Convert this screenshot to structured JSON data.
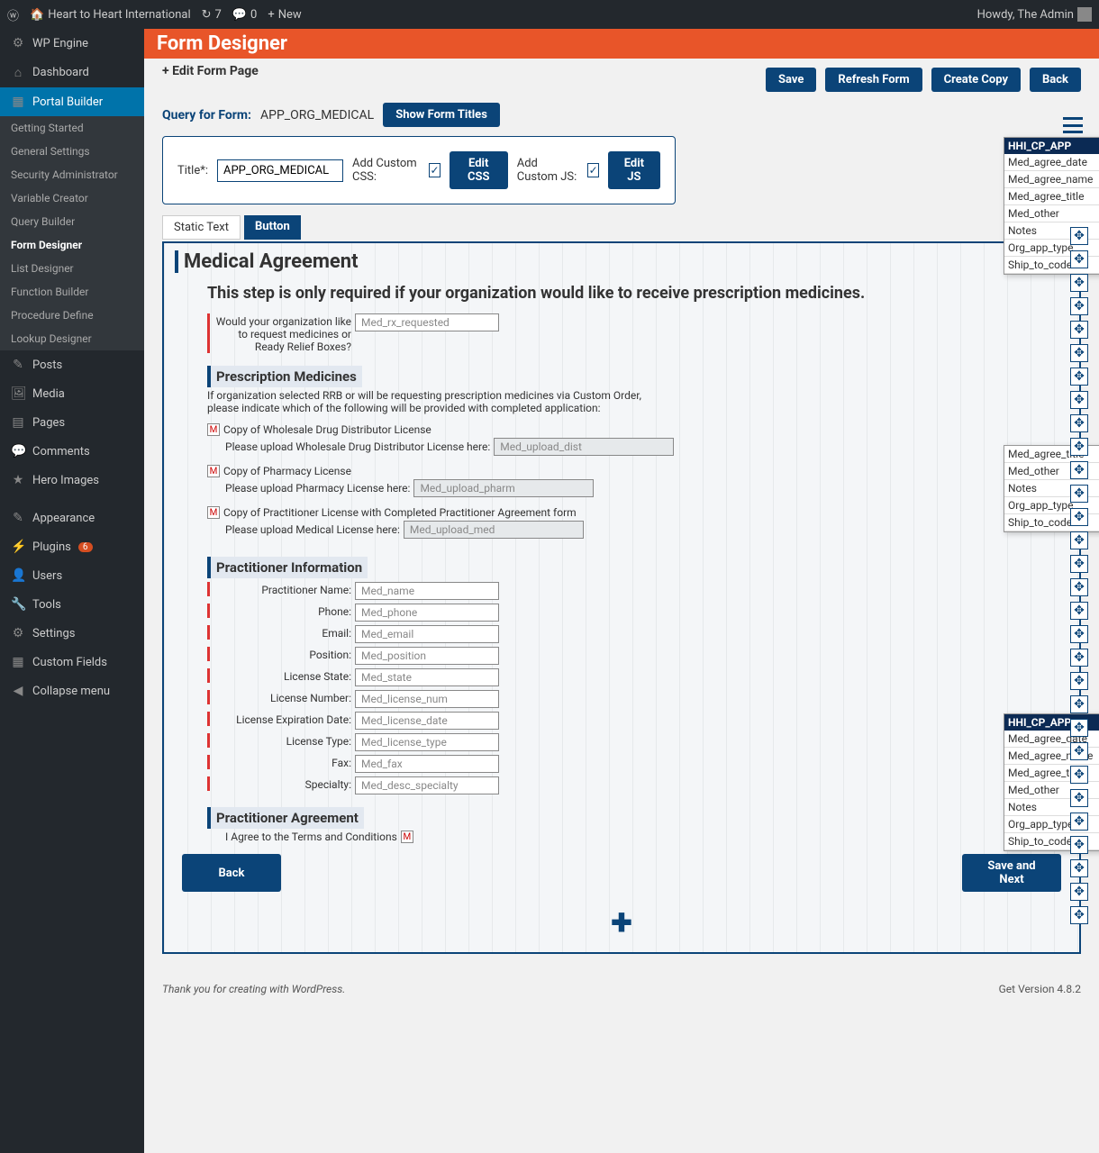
{
  "adminbar": {
    "site": "Heart to Heart International",
    "updates": "7",
    "comments": "0",
    "new": "New",
    "howdy": "Howdy, The Admin"
  },
  "sidebar": {
    "items": [
      {
        "label": "WP Engine"
      },
      {
        "label": "Dashboard"
      },
      {
        "label": "Portal Builder",
        "active": true
      },
      {
        "label": "Posts"
      },
      {
        "label": "Media"
      },
      {
        "label": "Pages"
      },
      {
        "label": "Comments"
      },
      {
        "label": "Hero Images"
      },
      {
        "label": "Appearance"
      },
      {
        "label": "Plugins",
        "badge": "6"
      },
      {
        "label": "Users"
      },
      {
        "label": "Tools"
      },
      {
        "label": "Settings"
      },
      {
        "label": "Custom Fields"
      },
      {
        "label": "Collapse menu"
      }
    ],
    "submenu": [
      "Getting Started",
      "General Settings",
      "Security Administrator",
      "Variable Creator",
      "Query Builder",
      "Form Designer",
      "List Designer",
      "Function Builder",
      "Procedure Define",
      "Lookup Designer"
    ],
    "submenu_active": "Form Designer"
  },
  "header": {
    "title": "Form Designer",
    "subtitle": "+ Edit Form Page",
    "buttons": {
      "save": "Save",
      "refresh": "Refresh Form",
      "copy": "Create Copy",
      "back": "Back"
    },
    "query_label": "Query for Form:",
    "query_value": "APP_ORG_MEDICAL",
    "show_titles": "Show Form Titles"
  },
  "titlebox": {
    "label": "Title*:",
    "value": "APP_ORG_MEDICAL",
    "css_label": "Add Custom CSS:",
    "edit_css": "Edit CSS",
    "js_label": "Add Custom JS:",
    "edit_js": "Edit JS"
  },
  "tabs": {
    "static": "Static Text",
    "button": "Button"
  },
  "form": {
    "main_title": "Medical Agreement",
    "step": "This step is only required if your organization would like to receive prescription medicines.",
    "q1_label": "Would your organization like to request medicines or Ready Relief Boxes?",
    "q1_ph": "Med_rx_requested",
    "rx_title": "Prescription Medicines",
    "rx_desc": "If organization selected RRB or will be requesting prescription medicines via Custom Order, please indicate which of the following will be provided with completed application:",
    "cb1": "Copy of Wholesale Drug Distributor License",
    "up1_label": "Please upload Wholesale Drug Distributor License here:",
    "up1_ph": "Med_upload_dist",
    "cb2": "Copy of Pharmacy License",
    "up2_label": "Please upload Pharmacy License here:",
    "up2_ph": "Med_upload_pharm",
    "cb3": "Copy of Practitioner License with Completed Practitioner Agreement form",
    "up3_label": "Please upload Medical License here:",
    "up3_ph": "Med_upload_med",
    "pi_title": "Practitioner Information",
    "fields": [
      {
        "label": "Practitioner Name:",
        "ph": "Med_name"
      },
      {
        "label": "Phone:",
        "ph": "Med_phone"
      },
      {
        "label": "Email:",
        "ph": "Med_email"
      },
      {
        "label": "Position:",
        "ph": "Med_position"
      },
      {
        "label": "License State:",
        "ph": "Med_state"
      },
      {
        "label": "License Number:",
        "ph": "Med_license_num"
      },
      {
        "label": "License Expiration Date:",
        "ph": "Med_license_date"
      },
      {
        "label": "License Type:",
        "ph": "Med_license_type"
      },
      {
        "label": "Fax:",
        "ph": "Med_fax"
      },
      {
        "label": "Specialty:",
        "ph": "Med_desc_specialty"
      }
    ],
    "pa_title": "Practitioner Agreement",
    "agree": "I Agree to the Terms and Conditions",
    "back": "Back",
    "save_next": "Save and Next"
  },
  "popup": {
    "header": "HHI_CP_APP",
    "rows": [
      "Med_agree_date",
      "Med_agree_name",
      "Med_agree_title",
      "Med_other",
      "Notes",
      "Org_app_type",
      "Ship_to_code"
    ]
  },
  "popup2": {
    "rows": [
      "Med_agree_title",
      "Med_other",
      "Notes",
      "Org_app_type",
      "Ship_to_code"
    ]
  },
  "footer": {
    "thanks": "Thank you for creating with WordPress.",
    "version": "Get Version 4.8.2"
  }
}
